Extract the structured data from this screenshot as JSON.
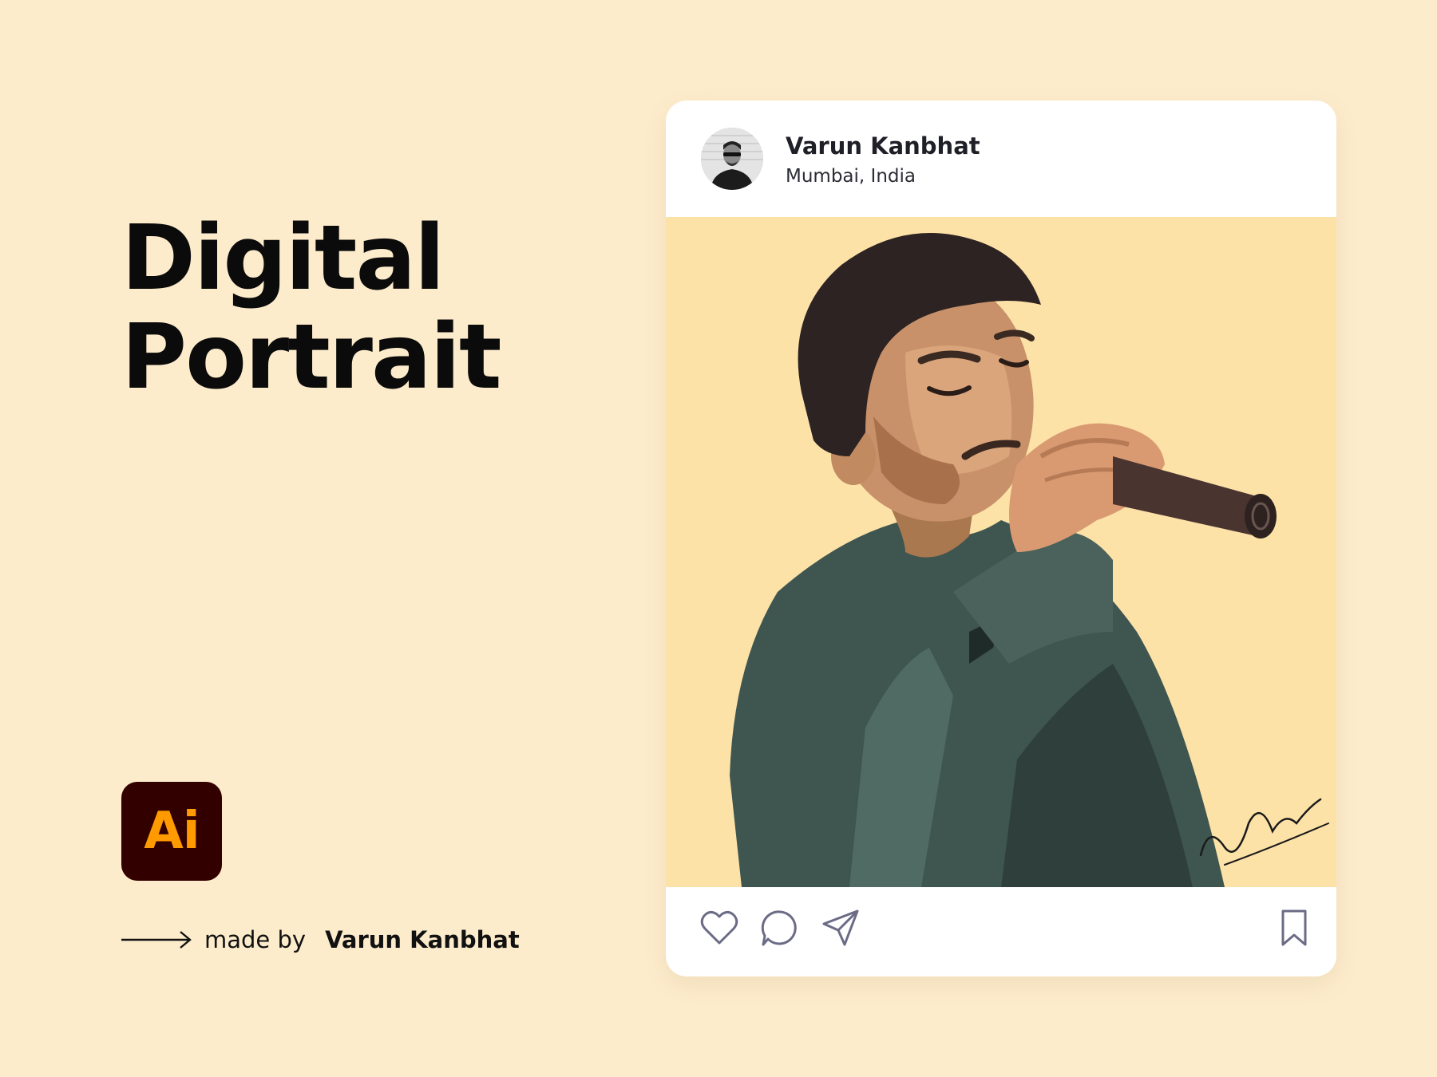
{
  "headline": {
    "line1": "Digital",
    "line2": "Portrait"
  },
  "tool_logo": {
    "text": "Ai",
    "background": "#330000",
    "foreground": "#ff9a00"
  },
  "credit": {
    "prefix": "made by",
    "author": "Varun Kanbhat"
  },
  "post": {
    "user_name": "Varun Kanbhat",
    "location": "Mumbai, India",
    "image_background": "#fde2a8",
    "signature": "V. Kanbhat",
    "actions": [
      "heart-icon",
      "comment-icon",
      "send-icon",
      "bookmark-icon"
    ]
  },
  "colors": {
    "page_background": "#fdeccc",
    "card": "#ffffff",
    "icon_stroke": "#6b6b86"
  }
}
